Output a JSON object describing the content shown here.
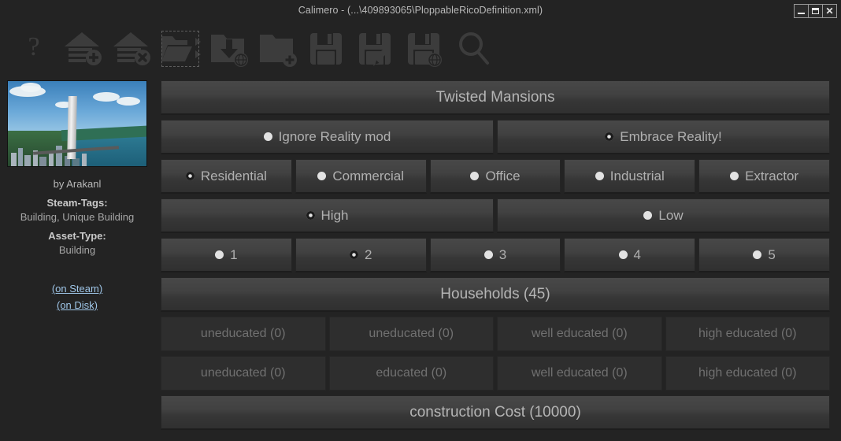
{
  "window": {
    "title": "Calimero - (...\\409893065\\PloppableRicoDefinition.xml)",
    "minimize_label": "_",
    "maximize_label": "□",
    "close_label": "✕"
  },
  "toolbar": {
    "items": [
      {
        "name": "help-icon",
        "tooltip": "Help"
      },
      {
        "name": "add-building-icon",
        "tooltip": "Add building"
      },
      {
        "name": "remove-building-icon",
        "tooltip": "Remove building"
      },
      {
        "name": "open-folder-icon",
        "tooltip": "Open folder",
        "selected": true
      },
      {
        "name": "folder-download-globe-icon",
        "tooltip": "Download from workshop"
      },
      {
        "name": "folder-add-icon",
        "tooltip": "New folder"
      },
      {
        "name": "save-icon",
        "tooltip": "Save"
      },
      {
        "name": "save-edit-icon",
        "tooltip": "Save as / edit"
      },
      {
        "name": "save-globe-icon",
        "tooltip": "Save to workshop"
      },
      {
        "name": "search-icon",
        "tooltip": "Search"
      }
    ]
  },
  "sidebar": {
    "thumbnail_alt": "Twisted Mansions city screenshot",
    "author": "by Arakanl",
    "steam_tags_label": "Steam-Tags:",
    "steam_tags_value": "Building, Unique Building",
    "asset_type_label": "Asset-Type:",
    "asset_type_value": "Building",
    "link_steam": "(on Steam)",
    "link_disk": "(on Disk)"
  },
  "panel": {
    "asset_name": "Twisted Mansions",
    "reality_options": [
      {
        "label": "Ignore Reality mod",
        "selected": false
      },
      {
        "label": "Embrace Reality!",
        "selected": true
      }
    ],
    "categories": [
      {
        "label": "Residential",
        "selected": true
      },
      {
        "label": "Commercial",
        "selected": false
      },
      {
        "label": "Office",
        "selected": false
      },
      {
        "label": "Industrial",
        "selected": false
      },
      {
        "label": "Extractor",
        "selected": false
      }
    ],
    "density": [
      {
        "label": "High",
        "selected": true
      },
      {
        "label": "Low",
        "selected": false
      }
    ],
    "levels": [
      {
        "label": "1",
        "selected": false
      },
      {
        "label": "2",
        "selected": true
      },
      {
        "label": "3",
        "selected": false
      },
      {
        "label": "4",
        "selected": false
      },
      {
        "label": "5",
        "selected": false
      }
    ],
    "households": "Households (45)",
    "workers_row_1": [
      "uneducated (0)",
      "uneducated (0)",
      "well educated (0)",
      "high educated (0)"
    ],
    "workers_row_2": [
      "uneducated (0)",
      "educated (0)",
      "well educated (0)",
      "high educated (0)"
    ],
    "construction_cost": "construction Cost (10000)"
  },
  "colors": {
    "background": "#232323",
    "button_top": "#484848",
    "button_bottom": "#303030",
    "text": "#b0b0b0",
    "link": "#9fc6e8",
    "disabled_bg": "#2e2e2e"
  }
}
